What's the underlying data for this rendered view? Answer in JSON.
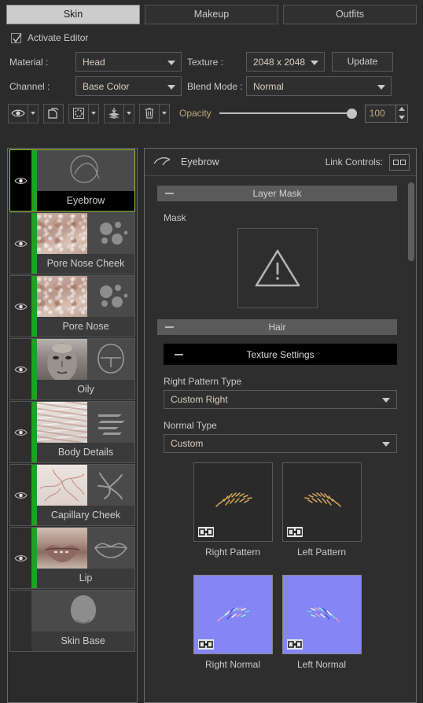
{
  "tabs": [
    {
      "label": "Skin",
      "active": true
    },
    {
      "label": "Makeup",
      "active": false
    },
    {
      "label": "Outfits",
      "active": false
    }
  ],
  "activate_editor": {
    "label": "Activate Editor",
    "checked": true
  },
  "form": {
    "material_label": "Material :",
    "material_value": "Head",
    "texture_label": "Texture :",
    "texture_value": "2048 x 2048",
    "update_label": "Update",
    "channel_label": "Channel :",
    "channel_value": "Base Color",
    "blend_label": "Blend Mode :",
    "blend_value": "Normal"
  },
  "toolbar": {
    "icons": [
      "eye-icon",
      "duplicate-icon",
      "selection-icon",
      "merge-layers-icon",
      "trash-icon"
    ],
    "opacity_label": "Opacity",
    "opacity_value": "100"
  },
  "layers": [
    {
      "name": "Eyebrow",
      "selected": true,
      "visible": true,
      "active_bar": true,
      "thumb": "eyebrow",
      "icon": "eyebrow-icon"
    },
    {
      "name": "Pore Nose Cheek",
      "selected": false,
      "visible": true,
      "active_bar": true,
      "thumb": "pore",
      "icon": "pores-icon"
    },
    {
      "name": "Pore Nose",
      "selected": false,
      "visible": true,
      "active_bar": true,
      "thumb": "pore",
      "icon": "pores-icon"
    },
    {
      "name": "Oily",
      "selected": false,
      "visible": true,
      "active_bar": true,
      "thumb": "face",
      "icon": "head-icon"
    },
    {
      "name": "Body Details",
      "selected": false,
      "visible": true,
      "active_bar": true,
      "thumb": "body",
      "icon": "lines-icon"
    },
    {
      "name": "Capillary Cheek",
      "selected": false,
      "visible": true,
      "active_bar": true,
      "thumb": "capillary",
      "icon": "veins-icon"
    },
    {
      "name": "Lip",
      "selected": false,
      "visible": true,
      "active_bar": true,
      "thumb": "lip",
      "icon": "lips-icon"
    },
    {
      "name": "Skin Base",
      "selected": false,
      "visible": false,
      "active_bar": false,
      "thumb": "skinbase",
      "icon": "head-filled-icon"
    }
  ],
  "panel": {
    "title": "Eyebrow",
    "title_icon": "eyebrow-icon",
    "link_controls_label": "Link Controls:",
    "sections": {
      "layer_mask": "Layer Mask",
      "hair": "Hair",
      "texture_settings": "Texture Settings"
    },
    "mask_label": "Mask",
    "mask_state": "warning-icon",
    "right_pattern_type_label": "Right Pattern Type",
    "right_pattern_type_value": "Custom Right",
    "normal_type_label": "Normal Type",
    "normal_type_value": "Custom",
    "tiles": [
      {
        "caption": "Right Pattern",
        "kind": "pattern",
        "linked": true
      },
      {
        "caption": "Left Pattern",
        "kind": "pattern",
        "linked": true
      },
      {
        "caption": "Right Normal",
        "kind": "normal",
        "linked": true
      },
      {
        "caption": "Left Normal",
        "kind": "normal",
        "linked": true
      }
    ]
  },
  "colors": {
    "background": "#2b2b2b",
    "panel": "#2e2e2e",
    "accent_green": "#21a021",
    "selection_border": "#9ac93a",
    "value_text": "#d8cfc0",
    "normal_map": "#8585f5"
  }
}
